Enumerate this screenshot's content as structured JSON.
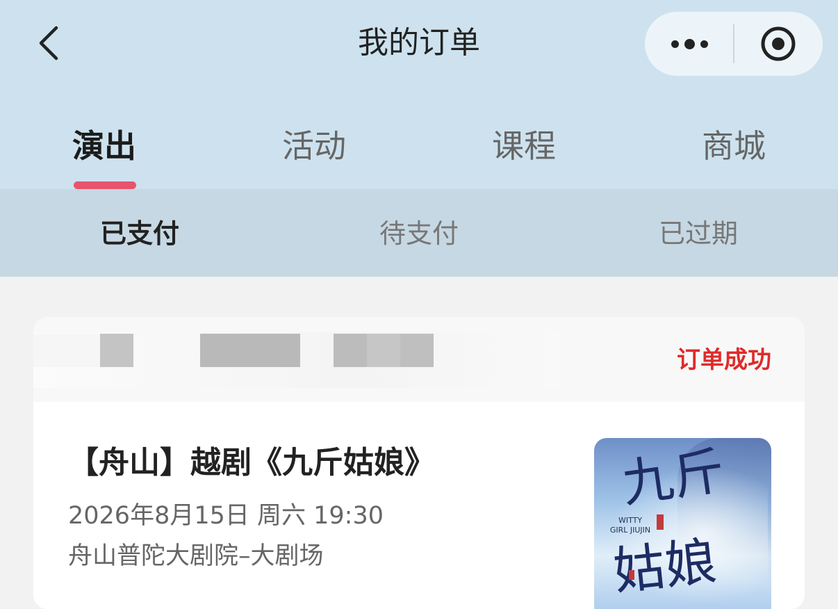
{
  "header": {
    "title": "我的订单"
  },
  "tabs": [
    {
      "label": "演出",
      "active": true
    },
    {
      "label": "活动",
      "active": false
    },
    {
      "label": "课程",
      "active": false
    },
    {
      "label": "商城",
      "active": false
    }
  ],
  "subtabs": [
    {
      "label": "已支付",
      "active": true
    },
    {
      "label": "待支付",
      "active": false
    },
    {
      "label": "已过期",
      "active": false
    }
  ],
  "order": {
    "status": "订单成功",
    "title": "【舟山】越剧《九斤姑娘》",
    "datetime": "2026年8月15日 周六 19:30",
    "venue": "舟山普陀大剧院–大剧场",
    "poster": {
      "title_glyphs_top": "九斤",
      "title_glyphs_bottom": "姑娘",
      "english": "WITTY GIRL JIUJIN"
    }
  },
  "colors": {
    "header_bg": "#cde2ee",
    "subtab_bg": "#c6d8e3",
    "accent": "#e8546e",
    "status_red": "#e02a2a"
  },
  "icons": {
    "back": "chevron-left-icon",
    "more": "more-dots-icon",
    "close": "target-circle-icon"
  }
}
